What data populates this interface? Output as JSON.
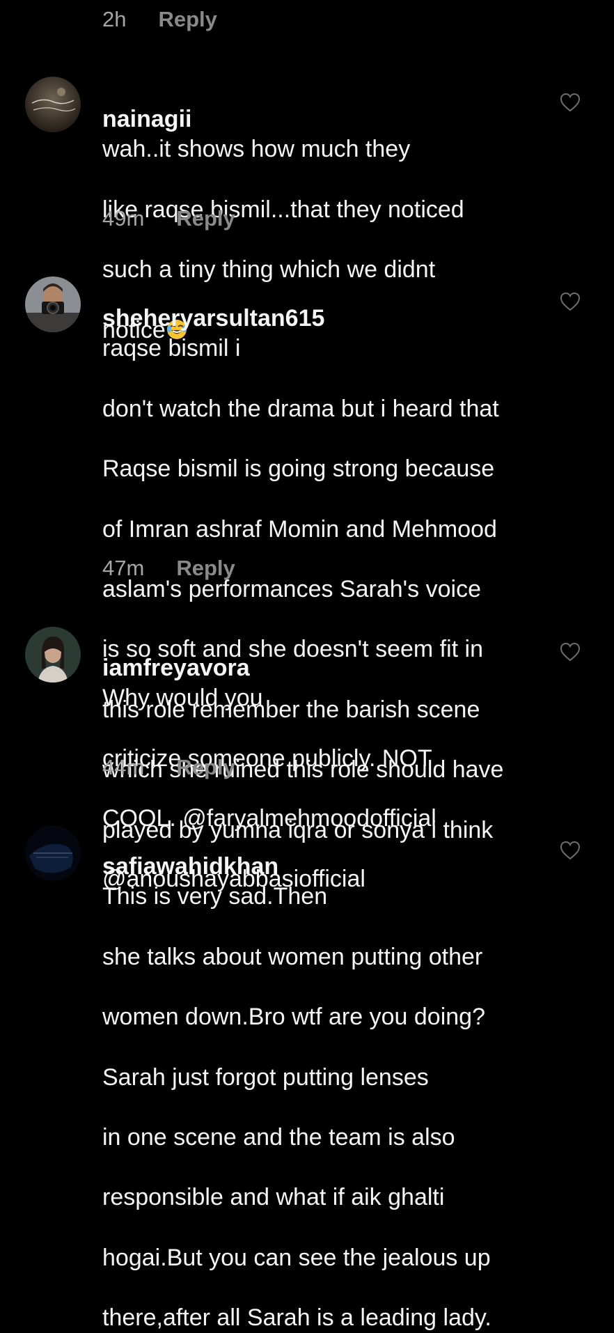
{
  "top_meta": {
    "time": "2h",
    "reply_label": "Reply"
  },
  "comments": [
    {
      "username": "nainagii",
      "lines": [
        "wah..it shows how much they",
        "like raqse bismil...that they noticed",
        "such a tiny thing which we didnt",
        "notice"
      ],
      "emoji": "rolling-on-floor-laughing-emoji",
      "time": "49m",
      "reply_label": "Reply"
    },
    {
      "username": "sheheryarsultan615",
      "lines": [
        "raqse bismil i",
        "don't watch the drama but i heard that",
        "Raqse bismil is going strong because",
        "of Imran ashraf Momin and Mehmood",
        "aslam's performances Sarah's voice",
        "is so soft and she doesn't seem fit in",
        "this role remember the barish scene",
        "which she ruined this role should have",
        "played by yumna iqra or sonya i think"
      ],
      "time": "47m",
      "reply_label": "Reply"
    },
    {
      "username": "iamfreyavora",
      "lines": [
        "Why would you",
        "criticize someone publicly. NOT",
        "COOL. @faryalmehmoodofficial",
        "@anoushayabbasiofficial"
      ],
      "time": "44m",
      "reply_label": "Reply"
    },
    {
      "username": "safiawahidkhan",
      "lines": [
        "This is very sad.Then",
        "she talks about women putting other",
        "women down.Bro wtf are you doing?",
        "Sarah just forgot putting lenses",
        "in one scene and the team is also",
        "responsible and what if aik ghalti",
        "hogai.But you can see the jealous up",
        "there,after all Sarah is a leading lady."
      ]
    }
  ],
  "colors": {
    "background": "#000000",
    "text": "#f5f5f5",
    "meta": "#a6a6a6",
    "reply": "#8a8a8a",
    "heart": "#6e6e6e"
  },
  "icons": [
    "heart-outline-icon"
  ]
}
